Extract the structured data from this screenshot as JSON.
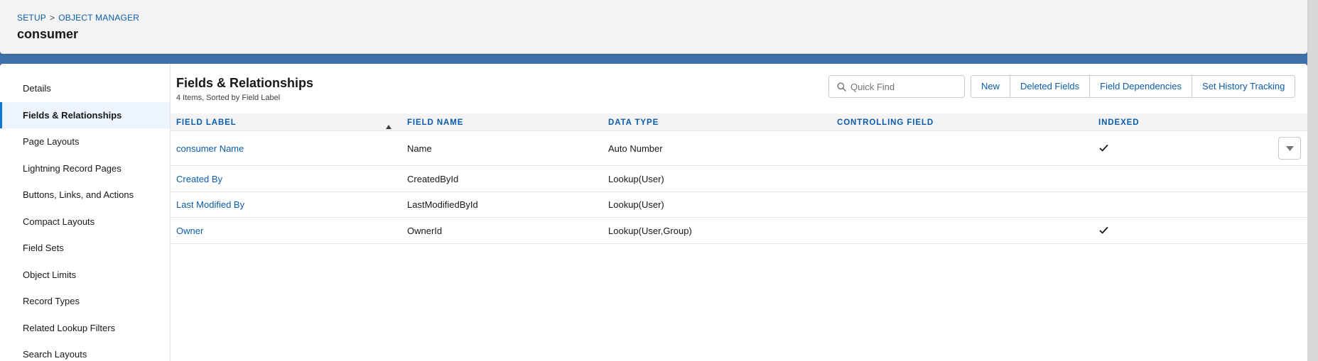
{
  "header": {
    "breadcrumb": [
      "SETUP",
      "OBJECT MANAGER"
    ],
    "breadcrumb_separator": ">",
    "title": "consumer"
  },
  "sidebar": {
    "items": [
      {
        "label": "Details",
        "active": false
      },
      {
        "label": "Fields & Relationships",
        "active": true
      },
      {
        "label": "Page Layouts",
        "active": false
      },
      {
        "label": "Lightning Record Pages",
        "active": false
      },
      {
        "label": "Buttons, Links, and Actions",
        "active": false
      },
      {
        "label": "Compact Layouts",
        "active": false
      },
      {
        "label": "Field Sets",
        "active": false
      },
      {
        "label": "Object Limits",
        "active": false
      },
      {
        "label": "Record Types",
        "active": false
      },
      {
        "label": "Related Lookup Filters",
        "active": false
      },
      {
        "label": "Search Layouts",
        "active": false
      }
    ]
  },
  "main": {
    "title": "Fields & Relationships",
    "subtitle": "4 Items, Sorted by Field Label",
    "search": {
      "placeholder": "Quick Find",
      "value": "",
      "icon": "search-icon"
    },
    "buttons": {
      "new": "New",
      "deleted_fields": "Deleted Fields",
      "field_dependencies": "Field Dependencies",
      "set_history_tracking": "Set History Tracking"
    },
    "table": {
      "sorted_by": "FIELD LABEL",
      "sort_direction": "ascending",
      "columns": {
        "field_label": "FIELD LABEL",
        "field_name": "FIELD NAME",
        "data_type": "DATA TYPE",
        "controlling_field": "CONTROLLING FIELD",
        "indexed": "INDEXED"
      },
      "rows": [
        {
          "field_label": "consumer Name",
          "field_name": "Name",
          "data_type": "Auto Number",
          "controlling_field": "",
          "indexed": true
        },
        {
          "field_label": "Created By",
          "field_name": "CreatedById",
          "data_type": "Lookup(User)",
          "controlling_field": "",
          "indexed": false
        },
        {
          "field_label": "Last Modified By",
          "field_name": "LastModifiedById",
          "data_type": "Lookup(User)",
          "controlling_field": "",
          "indexed": false
        },
        {
          "field_label": "Owner",
          "field_name": "OwnerId",
          "data_type": "Lookup(User,Group)",
          "controlling_field": "",
          "indexed": true
        }
      ]
    }
  },
  "colors": {
    "link": "#0b5cab",
    "active_nav_bg": "#eef4ff",
    "active_nav_accent": "#0176d3",
    "header_bg": "#f3f3f3",
    "band_bg": "#3f72a8"
  }
}
